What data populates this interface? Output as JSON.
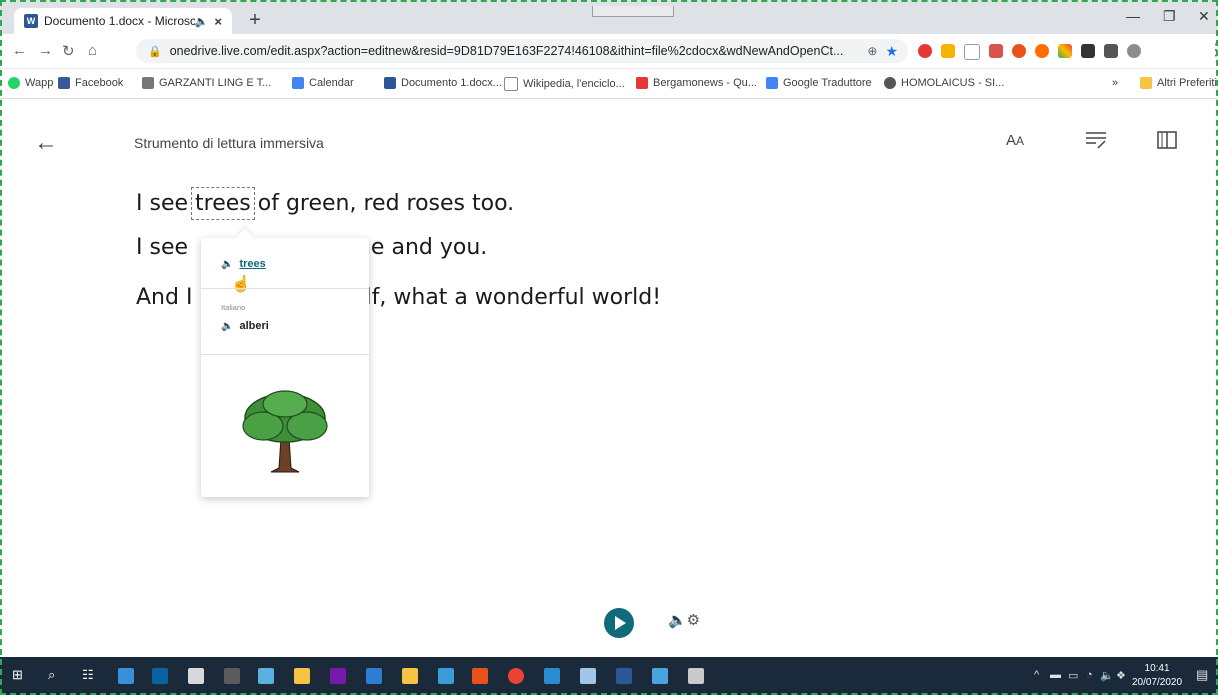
{
  "browser": {
    "tab_title": "Documento 1.docx - Microsc",
    "tab_audio_icon": "speaker-icon",
    "tab_close": "×",
    "new_tab": "+",
    "url": "onedrive.live.com/edit.aspx?action=editnew&resid=9D81D79E163F2274!46108&ithint=file%2cdocx&wdNewAndOpenCt...",
    "bookmarks": [
      {
        "label": "Wapp",
        "color": "#25d366"
      },
      {
        "label": "Facebook",
        "color": "#3b5998"
      },
      {
        "label": "GARZANTI LING E T...",
        "color": "#777777"
      },
      {
        "label": "Calendar",
        "color": "#4285f4"
      },
      {
        "label": "Documento 1.docx...",
        "color": "#2b5797"
      },
      {
        "label": "Wikipedia, l'enciclo...",
        "color": "#333333"
      },
      {
        "label": "Bergamonews - Qu...",
        "color": "#e53935"
      },
      {
        "label": "Google Traduttore",
        "color": "#4285f4"
      },
      {
        "label": "HOMOLAICUS - SI...",
        "color": "#555555"
      },
      {
        "label": "Altri Preferiti",
        "color": "#f6c343"
      }
    ],
    "bookmarks_overflow": "»"
  },
  "reader": {
    "title": "Strumento di lettura immersiva",
    "lines": [
      {
        "before": "I see ",
        "word": "trees",
        "after": " of green, red roses too."
      },
      {
        "text": "I see",
        "tail": "or me and you."
      },
      {
        "text": "And I",
        "tail": "elf, what a wonderful world!"
      }
    ],
    "popup": {
      "word": "trees",
      "language": "Italiano",
      "translation": "alberi",
      "picture": "tree-picture"
    },
    "icons": [
      "text-size-icon",
      "grammar-options-icon",
      "reading-preferences-icon"
    ],
    "play": "play-icon",
    "voice_settings": "voice-settings-icon"
  },
  "taskbar": {
    "time": "10:41",
    "date": "20/07/2020"
  }
}
